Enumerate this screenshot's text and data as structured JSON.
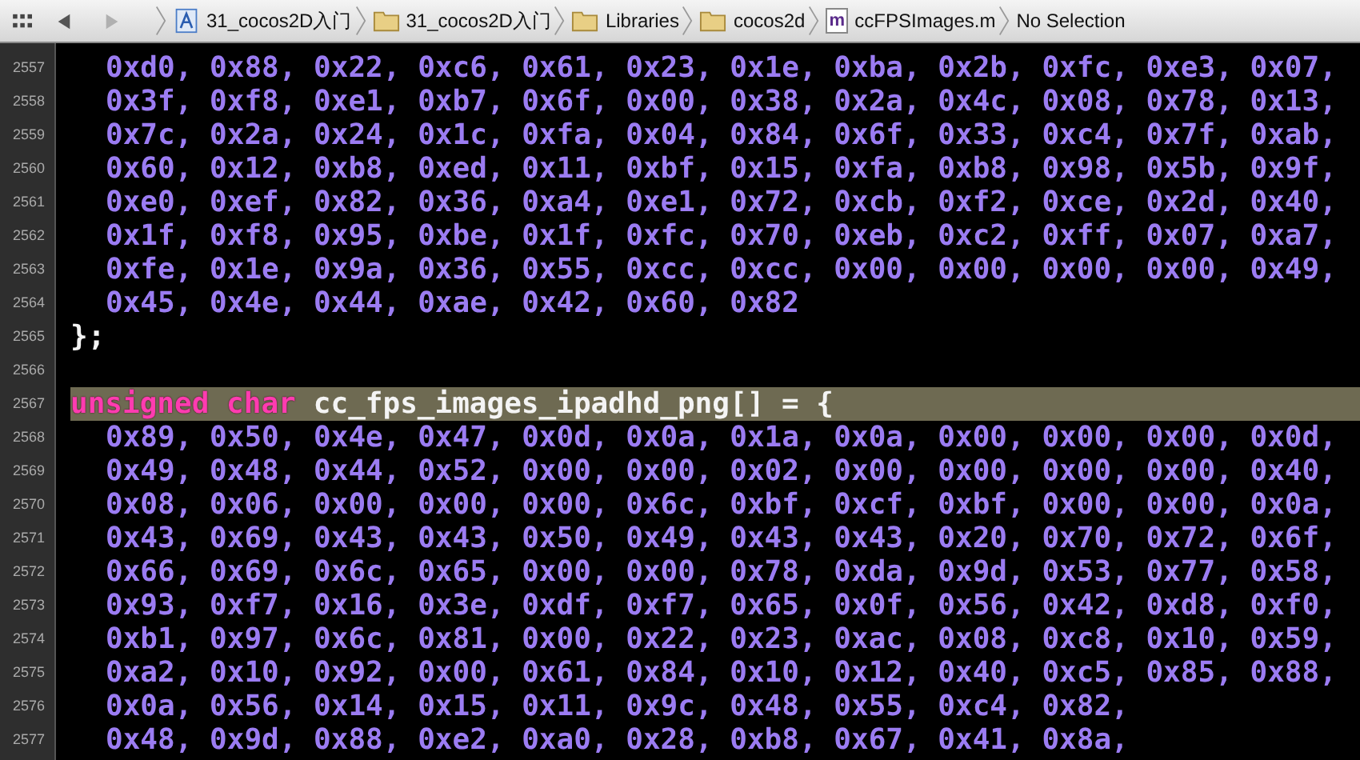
{
  "nav_buttons": [
    {
      "kind": "back",
      "disabled": false
    },
    {
      "kind": "forward",
      "disabled": true
    }
  ],
  "breadcrumb": [
    {
      "kind": "project",
      "label": "31_cocos2D入门"
    },
    {
      "kind": "folder",
      "label": "31_cocos2D入门"
    },
    {
      "kind": "folder",
      "label": "Libraries"
    },
    {
      "kind": "folder",
      "label": "cocos2d"
    },
    {
      "kind": "file",
      "label": "ccFPSImages.m",
      "badge": "m"
    },
    {
      "kind": "text",
      "label": "No Selection"
    }
  ],
  "lines": [
    {
      "number": "2557",
      "kind": "hex",
      "text": "0xd0, 0x88, 0x22, 0xc6, 0x61, 0x23, 0x1e, 0xba, 0x2b, 0xfc, 0xe3, 0x07,",
      "highlighted": false
    },
    {
      "number": "2558",
      "kind": "hex",
      "text": "0x3f, 0xf8, 0xe1, 0xb7, 0x6f, 0x00, 0x38, 0x2a, 0x4c, 0x08, 0x78, 0x13,",
      "highlighted": false
    },
    {
      "number": "2559",
      "kind": "hex",
      "text": "0x7c, 0x2a, 0x24, 0x1c, 0xfa, 0x04, 0x84, 0x6f, 0x33, 0xc4, 0x7f, 0xab,",
      "highlighted": false
    },
    {
      "number": "2560",
      "kind": "hex",
      "text": "0x60, 0x12, 0xb8, 0xed, 0x11, 0xbf, 0x15, 0xfa, 0xb8, 0x98, 0x5b, 0x9f,",
      "highlighted": false
    },
    {
      "number": "2561",
      "kind": "hex",
      "text": "0xe0, 0xef, 0x82, 0x36, 0xa4, 0xe1, 0x72, 0xcb, 0xf2, 0xce, 0x2d, 0x40,",
      "highlighted": false
    },
    {
      "number": "2562",
      "kind": "hex",
      "text": "0x1f, 0xf8, 0x95, 0xbe, 0x1f, 0xfc, 0x70, 0xeb, 0xc2, 0xff, 0x07, 0xa7,",
      "highlighted": false
    },
    {
      "number": "2563",
      "kind": "hex",
      "text": "0xfe, 0x1e, 0x9a, 0x36, 0x55, 0xcc, 0xcc, 0x00, 0x00, 0x00, 0x00, 0x49,",
      "highlighted": false
    },
    {
      "number": "2564",
      "kind": "hex",
      "text": "0x45, 0x4e, 0x44, 0xae, 0x42, 0x60, 0x82",
      "highlighted": false
    },
    {
      "number": "2565",
      "kind": "code",
      "text": "};",
      "highlighted": false
    },
    {
      "number": "2566",
      "kind": "blank",
      "highlighted": false
    },
    {
      "number": "2567",
      "kind": "decl",
      "keyword": "unsigned char",
      "text": "cc_fps_images_ipadhd_png[] = {",
      "highlighted": true
    },
    {
      "number": "2568",
      "kind": "hex",
      "text": "0x89, 0x50, 0x4e, 0x47, 0x0d, 0x0a, 0x1a, 0x0a, 0x00, 0x00, 0x00, 0x0d,",
      "highlighted": false
    },
    {
      "number": "2569",
      "kind": "hex",
      "text": "0x49, 0x48, 0x44, 0x52, 0x00, 0x00, 0x02, 0x00, 0x00, 0x00, 0x00, 0x40,",
      "highlighted": false
    },
    {
      "number": "2570",
      "kind": "hex",
      "text": "0x08, 0x06, 0x00, 0x00, 0x00, 0x6c, 0xbf, 0xcf, 0xbf, 0x00, 0x00, 0x0a,",
      "highlighted": false
    },
    {
      "number": "2571",
      "kind": "hex",
      "text": "0x43, 0x69, 0x43, 0x43, 0x50, 0x49, 0x43, 0x43, 0x20, 0x70, 0x72, 0x6f,",
      "highlighted": false
    },
    {
      "number": "2572",
      "kind": "hex",
      "text": "0x66, 0x69, 0x6c, 0x65, 0x00, 0x00, 0x78, 0xda, 0x9d, 0x53, 0x77, 0x58,",
      "highlighted": false
    },
    {
      "number": "2573",
      "kind": "hex",
      "text": "0x93, 0xf7, 0x16, 0x3e, 0xdf, 0xf7, 0x65, 0x0f, 0x56, 0x42, 0xd8, 0xf0,",
      "highlighted": false
    },
    {
      "number": "2574",
      "kind": "hex",
      "text": "0xb1, 0x97, 0x6c, 0x81, 0x00, 0x22, 0x23, 0xac, 0x08, 0xc8, 0x10, 0x59,",
      "highlighted": false
    },
    {
      "number": "2575",
      "kind": "hex",
      "text": "0xa2, 0x10, 0x92, 0x00, 0x61, 0x84, 0x10, 0x12, 0x40, 0xc5, 0x85, 0x88,",
      "highlighted": false
    },
    {
      "number": "2576",
      "kind": "hex",
      "text": "0x0a, 0x56, 0x14, 0x15, 0x11, 0x9c, 0x48, 0x55, 0xc4, 0x82,",
      "highlighted": false
    },
    {
      "number": "2577",
      "kind": "hex",
      "text": "0x48, 0x9d, 0x88, 0xe2, 0xa0, 0x28, 0xb8, 0x67, 0x41, 0x8a,",
      "highlighted": false
    }
  ]
}
